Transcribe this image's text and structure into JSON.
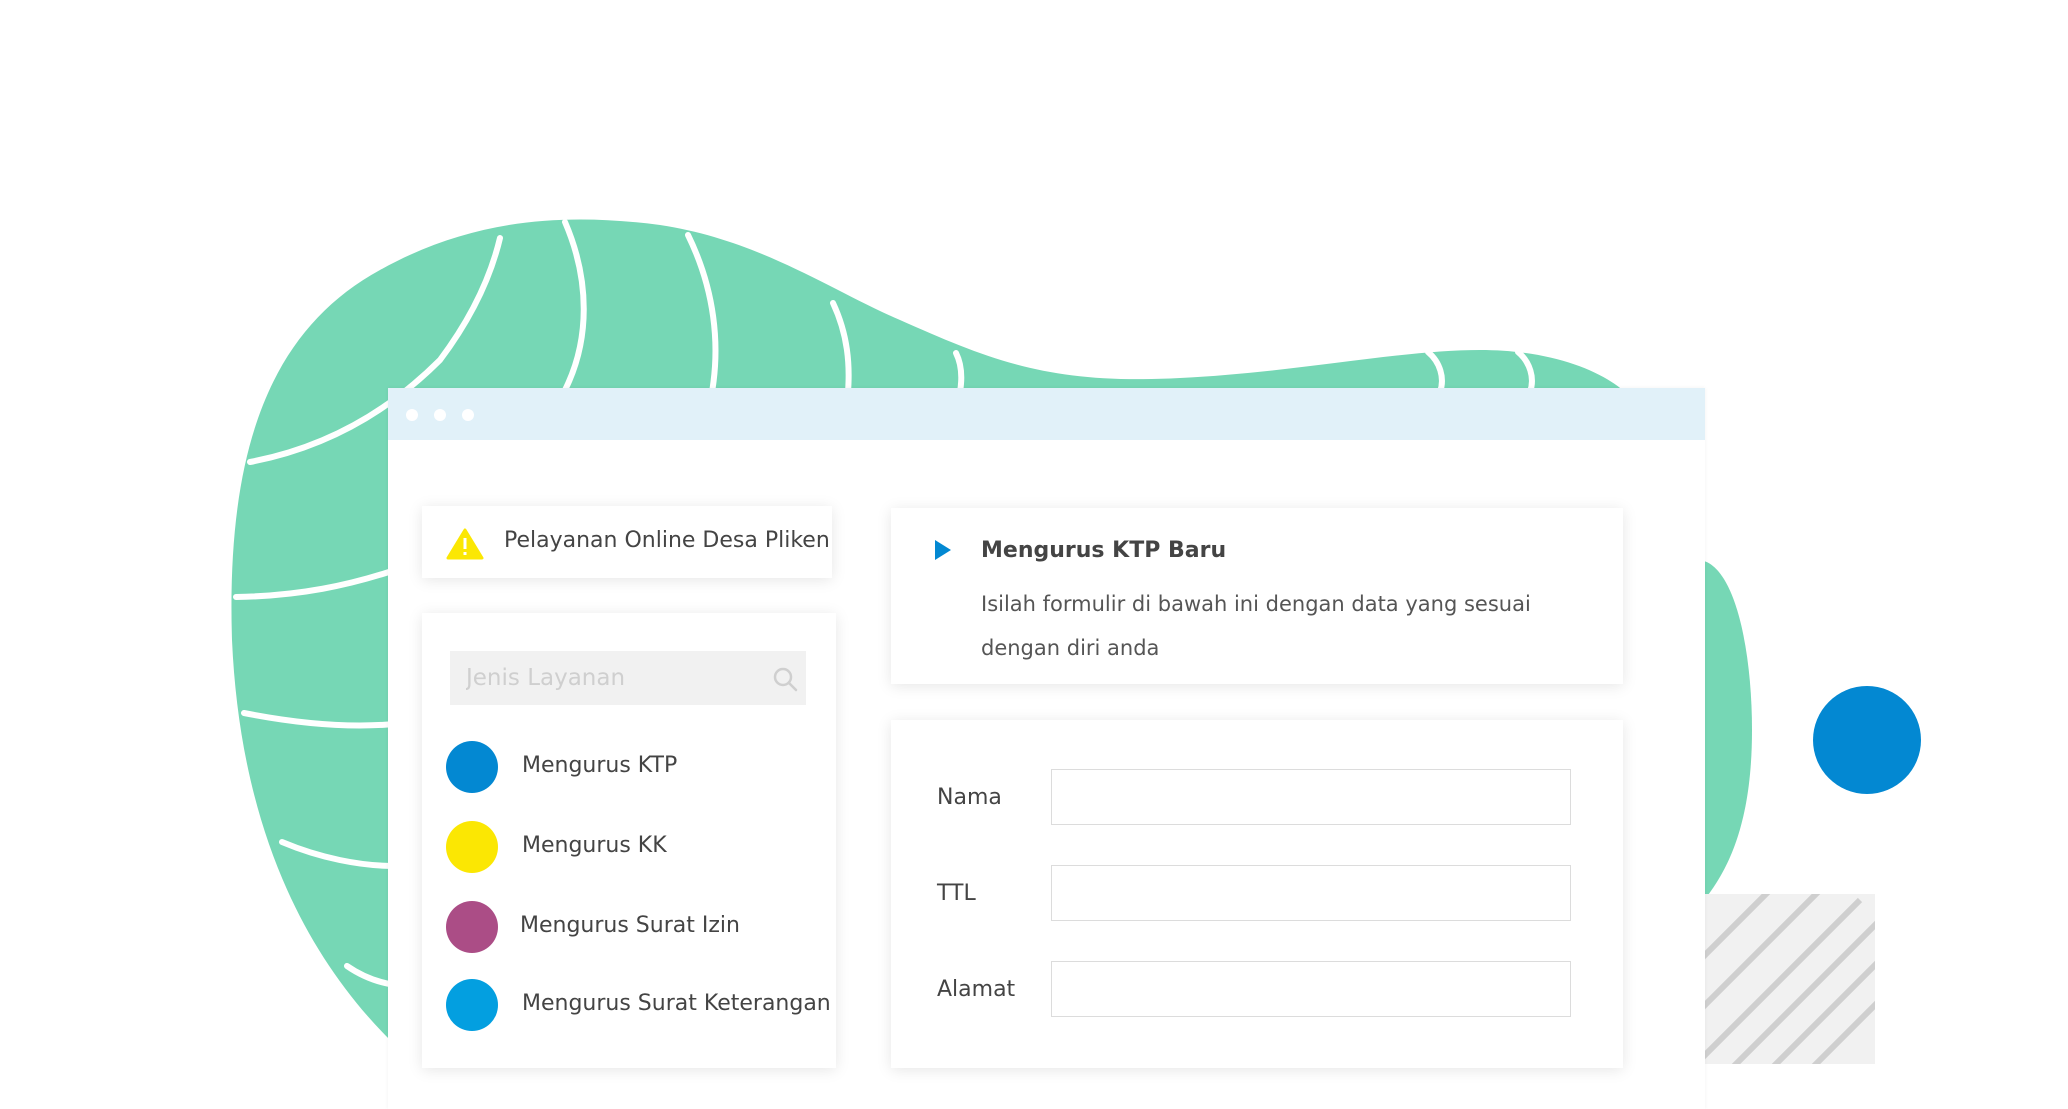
{
  "notice": {
    "icon": "warning-icon",
    "text": "Pelayanan Online Desa Pliken"
  },
  "sidebar": {
    "search_placeholder": "Jenis Layanan",
    "items": [
      {
        "label": "Mengurus KTP",
        "color": "#0388d2"
      },
      {
        "label": "Mengurus KK",
        "color": "#fbe703"
      },
      {
        "label": "Mengurus Surat Izin",
        "color": "#ab4d86"
      },
      {
        "label": "Mengurus Surat Keterangan",
        "color": "#039fe0"
      }
    ]
  },
  "info": {
    "title": "Mengurus KTP Baru",
    "description": "Isilah formulir di bawah ini dengan data yang sesuai dengan diri anda"
  },
  "form": {
    "fields": [
      {
        "label": "Nama",
        "value": ""
      },
      {
        "label": "TTL",
        "value": ""
      },
      {
        "label": "Alamat",
        "value": ""
      }
    ]
  },
  "colors": {
    "blob": "#76d7b5",
    "titlebar": "#e1f1f9",
    "accent_blue": "#0388d2",
    "play_icon": "#0388d2"
  }
}
